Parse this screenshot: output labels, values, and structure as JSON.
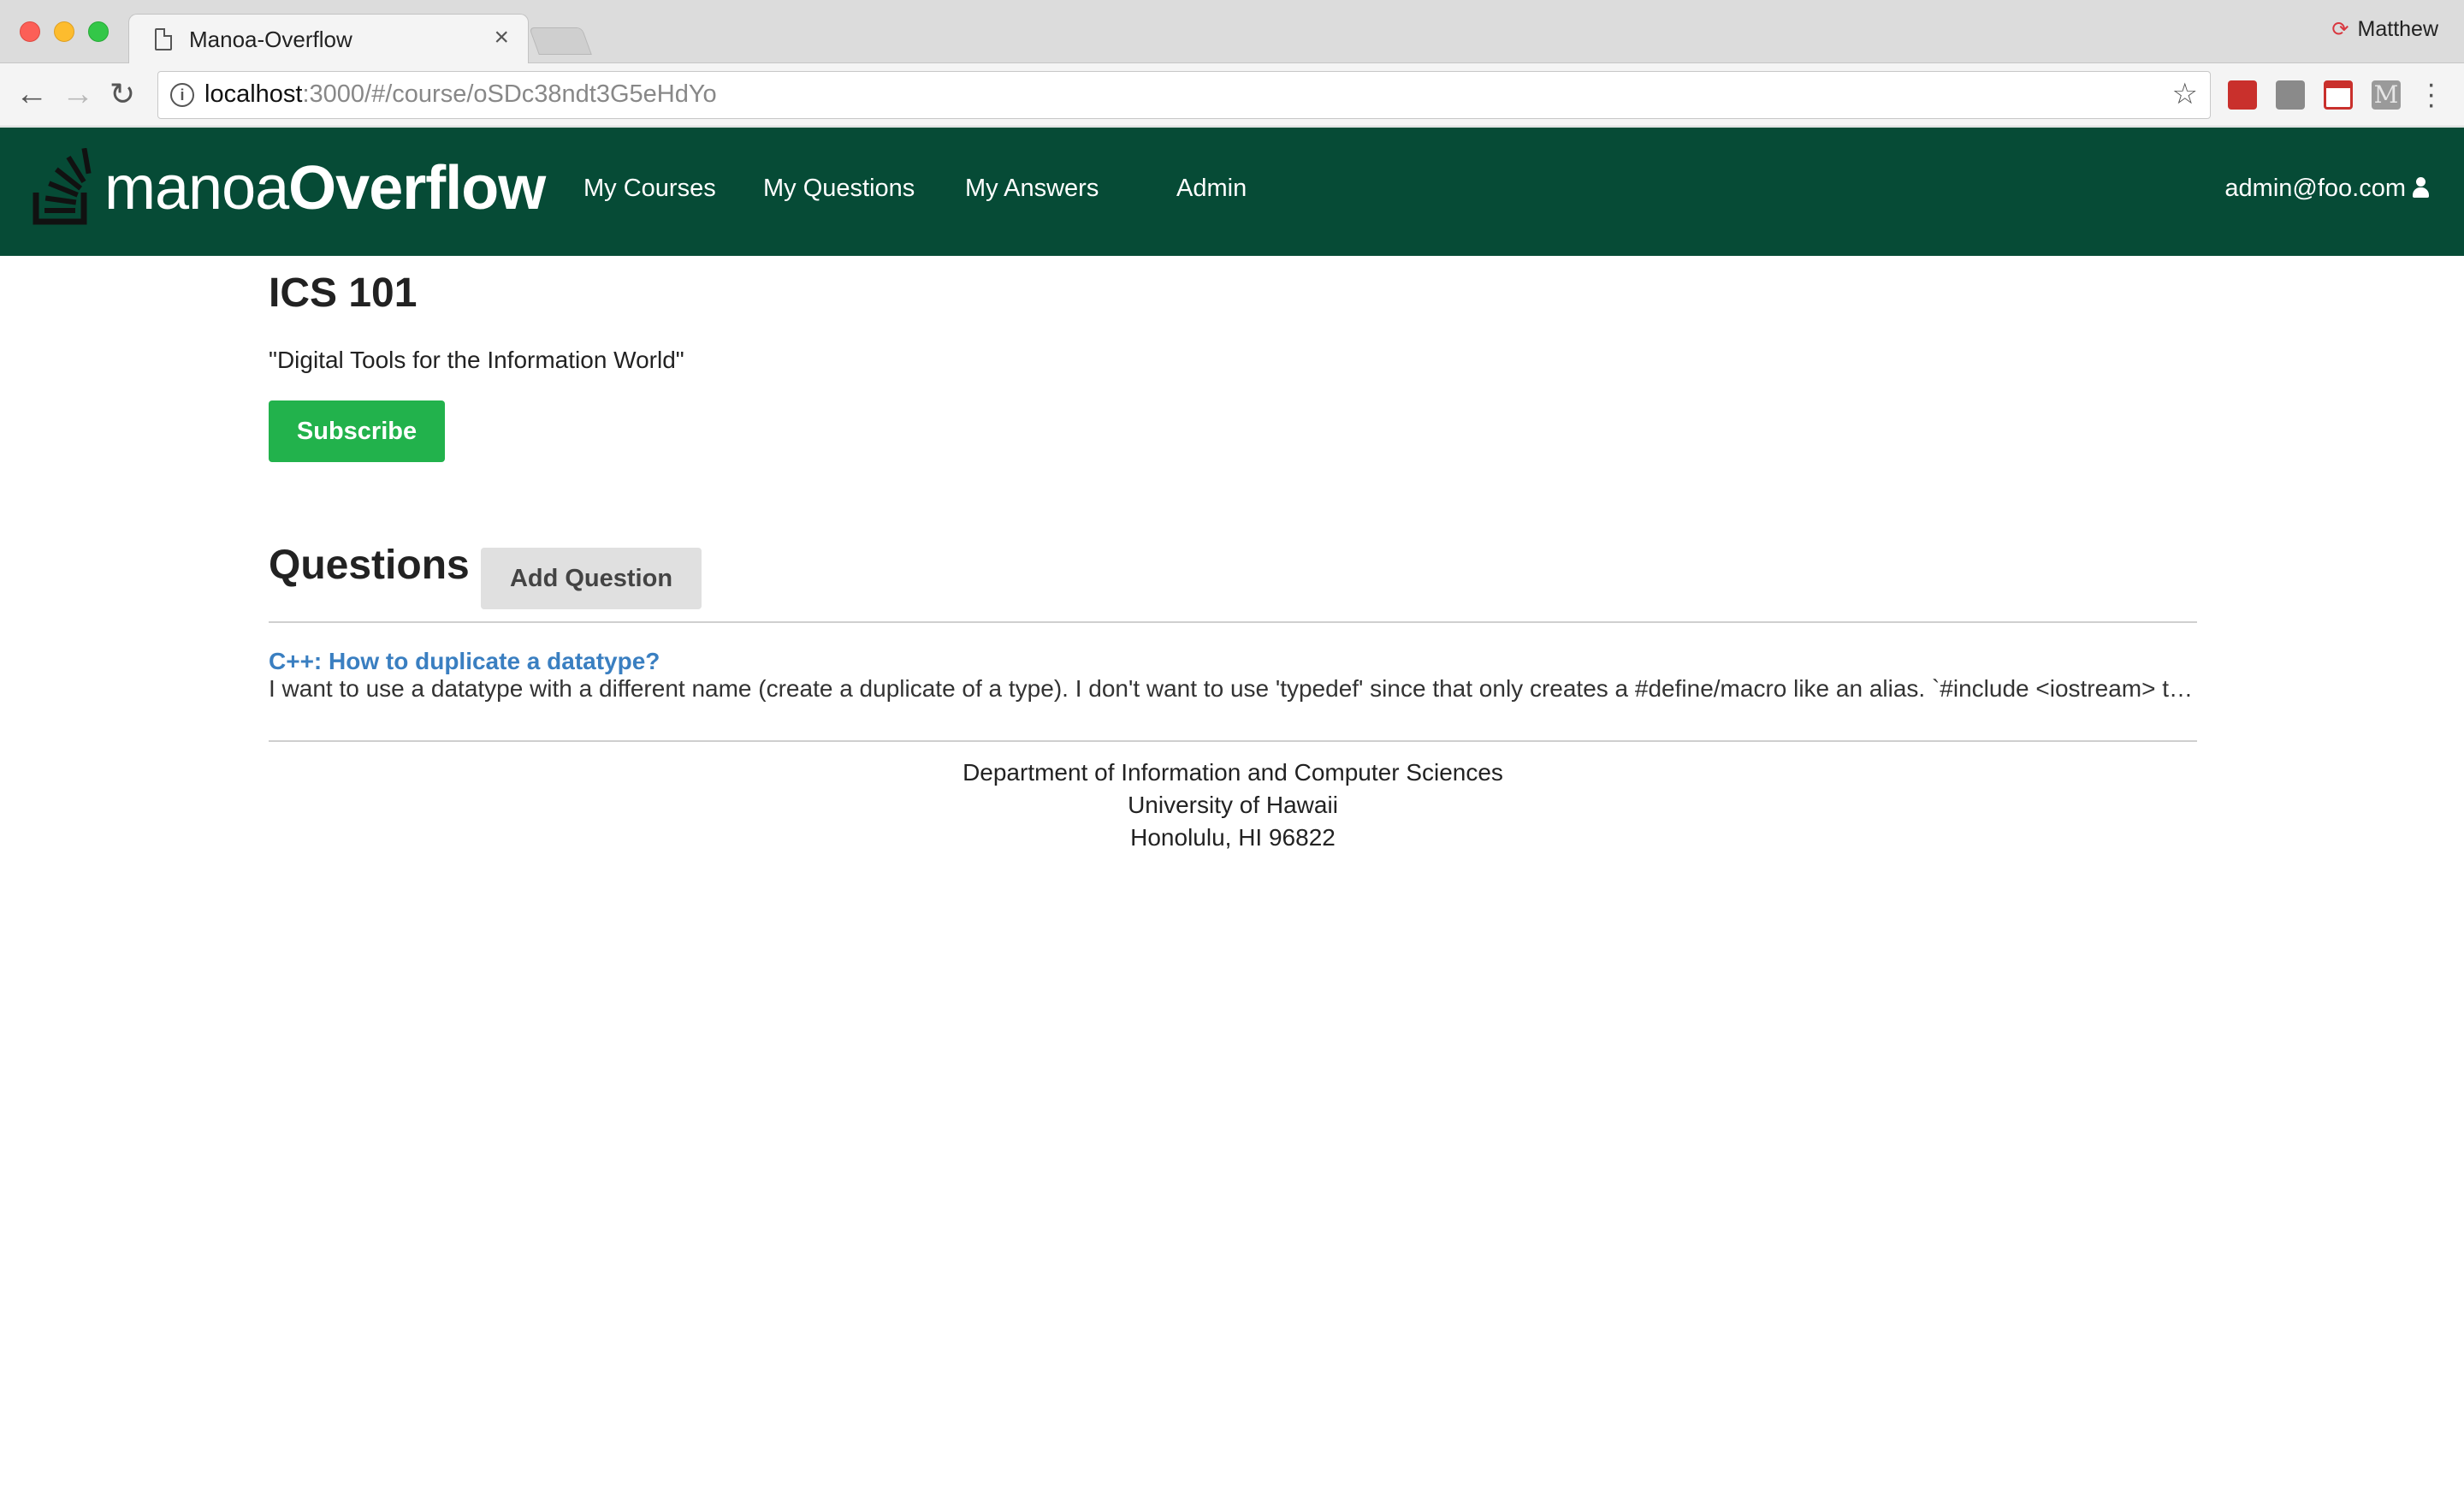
{
  "browser": {
    "tab_title": "Manoa-Overflow",
    "tab_close": "×",
    "profile_name": "Matthew",
    "url_host": "localhost",
    "url_path": ":3000/#/course/oSDc38ndt3G5eHdYo",
    "ext4_label": "M"
  },
  "navbar": {
    "brand_light": "manoa",
    "brand_bold": "Overflow",
    "links": [
      "My Courses",
      "My Questions",
      "My Answers",
      "Admin"
    ],
    "user": "admin@foo.com"
  },
  "course": {
    "title": "ICS 101",
    "subtitle": "\"Digital Tools for the Information World\"",
    "subscribe_label": "Subscribe"
  },
  "questions": {
    "heading": "Questions",
    "add_label": "Add Question",
    "items": [
      {
        "title": "C++: How to duplicate a datatype?",
        "body": "I want to use a datatype with a different name (create a duplicate of a type). I don't want to use 'typedef' since that only creates a #define/macro like an alias. `#include <iostream> typed..."
      }
    ]
  },
  "footer": {
    "lines": [
      "Department of Information and Computer Sciences",
      "University of Hawaii",
      "Honolulu, HI 96822"
    ]
  },
  "colors": {
    "navbar_bg": "#064b36",
    "subscribe_bg": "#22b24c",
    "link": "#3a7fc1"
  }
}
